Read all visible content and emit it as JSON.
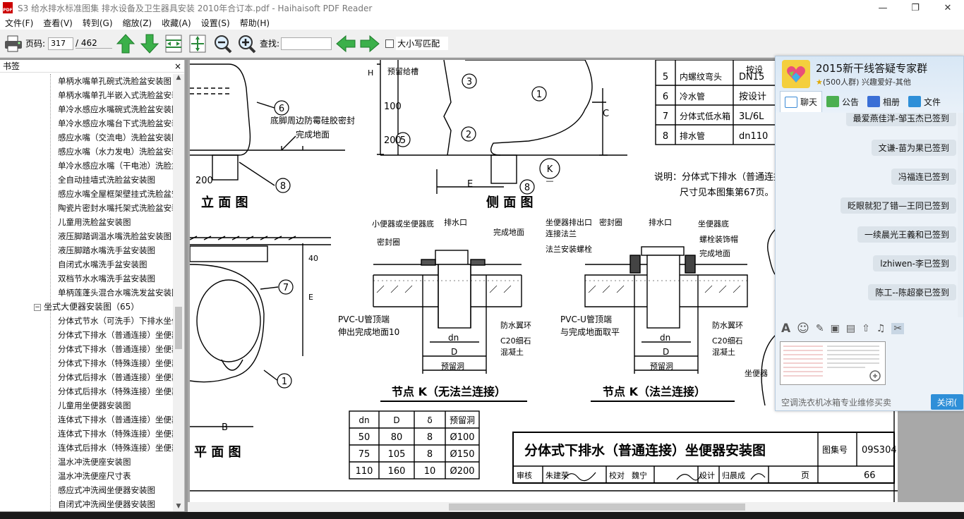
{
  "window": {
    "title": "S3 给水排水标准图集 排水设备及卫生器具安装 2010年合订本.pdf - Haihaisoft PDF Reader",
    "min": "—",
    "restore": "❐",
    "close": "✕"
  },
  "menu": [
    "文件(F)",
    "查看(V)",
    "转到(G)",
    "缩放(Z)",
    "收藏(A)",
    "设置(S)",
    "帮助(H)"
  ],
  "toolbar": {
    "page_label": "页码:",
    "page_value": "317",
    "page_total": "/ 462",
    "find_label": "查找:",
    "find_value": "",
    "match_case": "大小写匹配"
  },
  "bookmarks": {
    "title": "书签",
    "close": "×",
    "items": [
      {
        "label": "单柄水嘴单孔碗式洗脸盆安装图",
        "level": 2
      },
      {
        "label": "单柄水嘴单孔半嵌入式洗脸盆安装图",
        "level": 2
      },
      {
        "label": "单冷水感应水嘴碗式洗脸盆安装图",
        "level": 2
      },
      {
        "label": "单冷水感应水嘴台下式洗脸盆安装图",
        "level": 2
      },
      {
        "label": "感应水嘴（交流电）洗脸盆安装图",
        "level": 2
      },
      {
        "label": "感应水嘴（水力发电）洗脸盆安装图",
        "level": 2
      },
      {
        "label": "单冷水感应水嘴（干电池）洗脸盆安装图",
        "level": 2
      },
      {
        "label": "全自动挂墙式洗脸盆安装图",
        "level": 2
      },
      {
        "label": "感应水嘴全屋框架壁挂式洗脸盆安装图",
        "level": 2
      },
      {
        "label": "陶瓷片密封水嘴托架式洗脸盆安装图",
        "level": 2
      },
      {
        "label": "儿童用洗脸盆安装图",
        "level": 2
      },
      {
        "label": "液压脚踏调温水嘴洗脸盆安装图",
        "level": 2
      },
      {
        "label": "液压脚踏水嘴洗手盆安装图",
        "level": 2
      },
      {
        "label": "自闭式水嘴洗手盆安装图",
        "level": 2
      },
      {
        "label": "双档节水水嘴洗手盆安装图",
        "level": 2
      },
      {
        "label": "单柄莲蓬头混合水嘴洗发盆安装图",
        "level": 2
      },
      {
        "label": "坐式大便器安装图（65）",
        "level": 1
      },
      {
        "label": "分体式节水（可洗手）下排水坐便器安装图",
        "level": 2
      },
      {
        "label": "分体式下排水（普通连接）坐便器安装图",
        "level": 2
      },
      {
        "label": "分体式下排水（普通连接）坐便器安装图",
        "level": 2
      },
      {
        "label": "分体式下排水（特殊连接）坐便器安装图",
        "level": 2
      },
      {
        "label": "分体式后排水（普通连接）坐便器安装图",
        "level": 2
      },
      {
        "label": "分体式后排水（特殊连接）坐便器安装图",
        "level": 2
      },
      {
        "label": "儿童用坐便器安装图",
        "level": 2
      },
      {
        "label": "连体式下排水（普通连接）坐便器安装图",
        "level": 2
      },
      {
        "label": "连体式下排水（特殊连接）坐便器安装图",
        "level": 2
      },
      {
        "label": "连体式后排水（特殊连接）坐便器安装图",
        "level": 2
      },
      {
        "label": "温水冲洗便座安装图",
        "level": 2
      },
      {
        "label": "温水冲洗便座尺寸表",
        "level": 2
      },
      {
        "label": "感应式冲洗阀坐便器安装图",
        "level": 2
      },
      {
        "label": "自闭式冲洗阀坐便器安装图",
        "level": 2
      }
    ]
  },
  "drawing": {
    "labels": {
      "front_view": "立 面 图",
      "side_view": "侧 面 图",
      "plan_view": "平 面 图",
      "node_a": "节点 K（无法兰连接）",
      "node_b": "节点 K（法兰连接）",
      "seal": "底脚周边防霉硅胶密封",
      "finish_floor": "完成地面",
      "reserved_pipe": "预留给槽",
      "dim_200": "200",
      "dim_100": "100",
      "dim_h": "H",
      "dim_c": "C",
      "dim_e": "E",
      "dim_b": "B",
      "dim_40": "40",
      "dim_10": "10",
      "note1": "说明：分体式下排水（普通连接）",
      "note2": "尺寸见本图集第67页。",
      "a_toilet_base": "小便器或坐便器底",
      "a_outlet": "排水口",
      "a_floor": "完成地面",
      "a_seal": "密封圈",
      "a_pvc1": "PVC-U管顶端",
      "a_pvc2": "伸出完成地面10",
      "a_ring": "防水翼环",
      "a_conc1": "C20细石",
      "a_conc2": "混凝土",
      "a_hole": "预留洞",
      "a_dn": "dn",
      "a_d": "D",
      "b_outlet1": "坐便器排出口",
      "b_outlet2": "连接法兰",
      "b_seal": "密封圈",
      "b_drain": "排水口",
      "b_base": "坐便器底",
      "b_bolt": "法兰安装螺栓",
      "b_deco": "螺栓装饰帽",
      "b_floor": "完成地面",
      "b_pvc1": "PVC-U管顶端",
      "b_pvc2": "与完成地面取平",
      "b_ring": "防水翼环",
      "b_conc1": "C20细石",
      "b_conc2": "混凝土",
      "b_hole": "预留洞",
      "b_dn": "dn",
      "b_d": "D",
      "b_toilet": "坐便器"
    },
    "parts": [
      [
        "5",
        "内螺纹弯头",
        "DN15"
      ],
      [
        "6",
        "冷水管",
        "按设计"
      ],
      [
        "7",
        "分体式低水箱",
        "3L/6L"
      ],
      [
        "8",
        "排水管",
        "dn110"
      ]
    ],
    "parts_partial": "按设",
    "dim_table": {
      "headers": [
        "dn",
        "D",
        "δ",
        "预留洞"
      ],
      "rows": [
        [
          "50",
          "80",
          "8",
          "Ø100"
        ],
        [
          "75",
          "105",
          "8",
          "Ø150"
        ],
        [
          "110",
          "160",
          "10",
          "Ø200"
        ]
      ]
    },
    "title_block": {
      "title": "分体式下排水（普通连接）坐便器安装图",
      "atlas_label": "图集号",
      "atlas_no": "09S304",
      "review": "审核",
      "reviewer": "朱建荣",
      "check": "校对",
      "checker": "魏宁",
      "design": "设计",
      "designer": "归晨成",
      "page_label": "页",
      "page_no": "66"
    },
    "circles": [
      "1",
      "2",
      "3",
      "5",
      "6",
      "7",
      "8",
      "K",
      "—"
    ]
  },
  "chat": {
    "group_name": "2015新干线答疑专家群",
    "group_sub": "(500人群) 兴趣爱好-其他",
    "star": "★",
    "tabs": [
      "聊天",
      "公告",
      "相册",
      "文件"
    ],
    "messages": [
      "最爱燕佳洋-邹玉杰已签到",
      "文谦-苗为果已签到",
      "冯福连已签到",
      "眨眼就犯了错—王同已签到",
      "一续晨光王義和已签到",
      "lzhiwen-李已签到",
      "陈工--陈超豪已签到"
    ],
    "footer_text": "空调洗衣机冰箱专业维修买卖",
    "close_label": "关闭(",
    "tools": [
      "A",
      "☺",
      "✎",
      "▣",
      "▤",
      "⇧",
      "♫",
      "✂"
    ]
  }
}
